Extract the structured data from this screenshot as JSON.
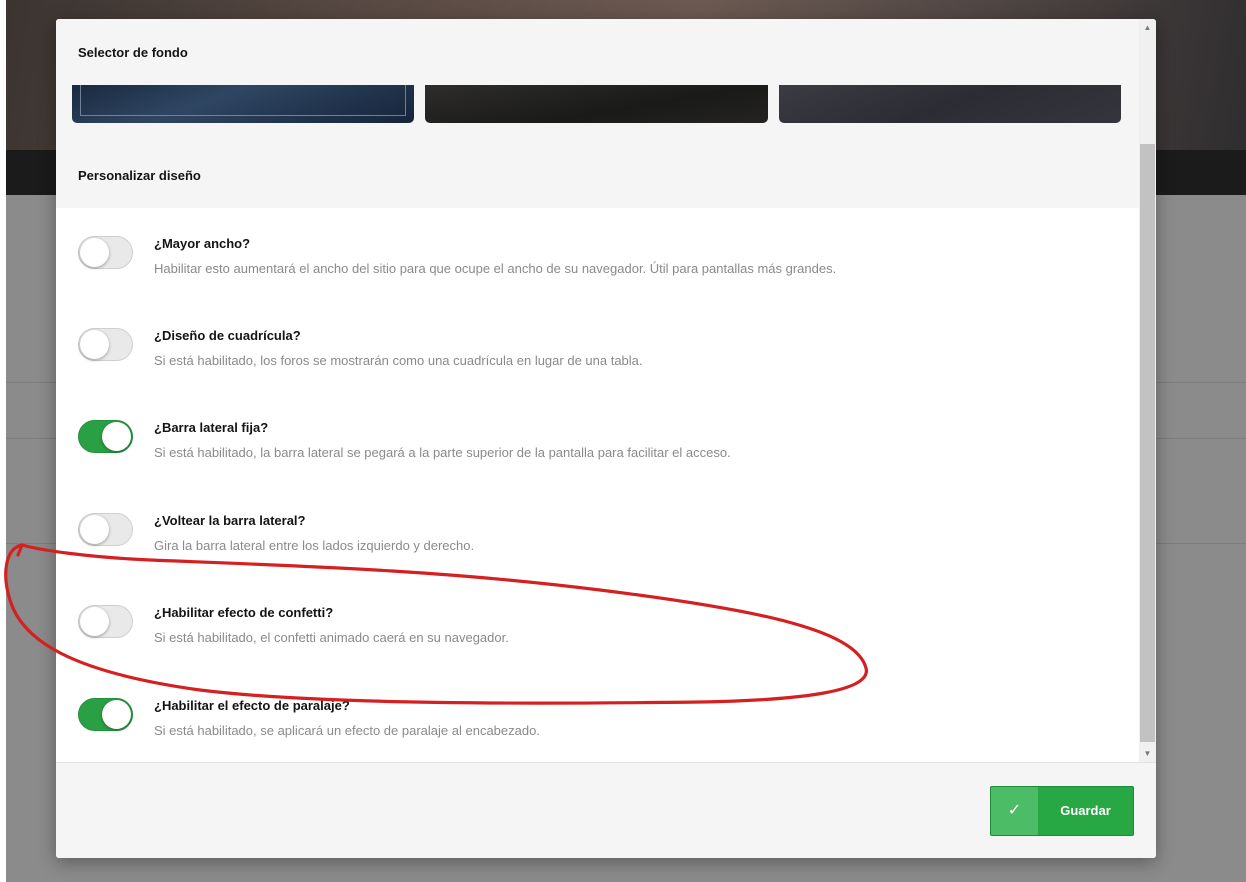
{
  "modal": {
    "background_section_title": "Selector de fondo",
    "customize_section_title": "Personalizar diseño",
    "options": [
      {
        "label": "¿Mayor ancho?",
        "description": "Habilitar esto aumentará el ancho del sitio para que ocupe el ancho de su navegador. Útil para pantallas más grandes.",
        "enabled": false
      },
      {
        "label": "¿Diseño de cuadrícula?",
        "description": "Si está habilitado, los foros se mostrarán como una cuadrícula en lugar de una tabla.",
        "enabled": false
      },
      {
        "label": "¿Barra lateral fija?",
        "description": "Si está habilitado, la barra lateral se pegará a la parte superior de la pantalla para facilitar el acceso.",
        "enabled": true
      },
      {
        "label": "¿Voltear la barra lateral?",
        "description": "Gira la barra lateral entre los lados izquierdo y derecho.",
        "enabled": false
      },
      {
        "label": "¿Habilitar efecto de confetti?",
        "description": "Si está habilitado, el confetti animado caerá en su navegador.",
        "enabled": false
      },
      {
        "label": "¿Habilitar el efecto de paralaje?",
        "description": "Si está habilitado, se aplicará un efecto de paralaje al encabezado.",
        "enabled": true
      }
    ],
    "save_label": "Guardar",
    "save_icon": "✓"
  },
  "colors": {
    "toggle_on": "#2aa044",
    "save_button": "#28a745",
    "annotation": "#d42020"
  }
}
